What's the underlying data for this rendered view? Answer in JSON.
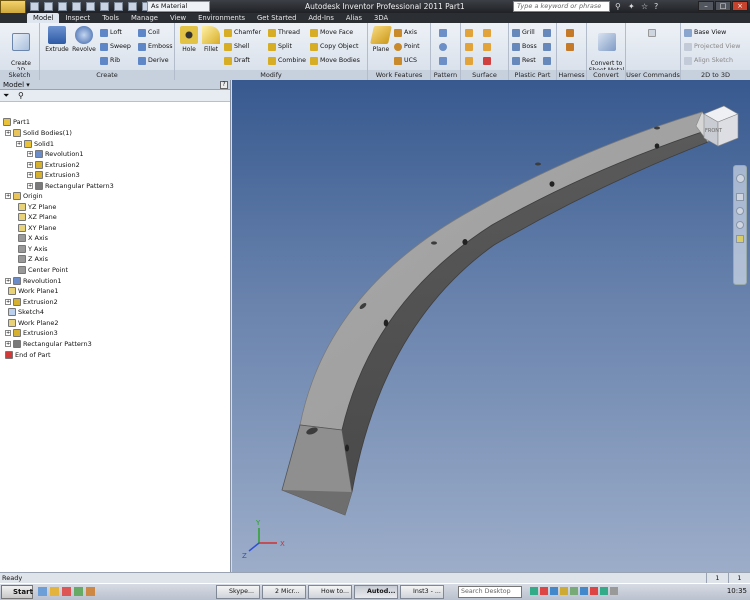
{
  "app": {
    "title": "Autodesk Inventor Professional 2011    Part1",
    "material": "As Material",
    "search_placeholder": "Type a keyword or phrase",
    "app_button": "PRO"
  },
  "tabs": [
    "Model",
    "Inspect",
    "Tools",
    "Manage",
    "View",
    "Environments",
    "Get Started",
    "Add-Ins",
    "Alias",
    "3DA"
  ],
  "ribbon": {
    "sketch": {
      "label": "Sketch",
      "create_2d_sketch": "Create\n2D Sketch"
    },
    "create": {
      "label": "Create",
      "extrude": "Extrude",
      "revolve": "Revolve",
      "loft": "Loft",
      "sweep": "Sweep",
      "rib": "Rib",
      "coil": "Coil",
      "emboss": "Emboss",
      "derive": "Derive"
    },
    "modify": {
      "label": "Modify",
      "hole": "Hole",
      "fillet": "Fillet",
      "chamfer": "Chamfer",
      "shell": "Shell",
      "draft": "Draft",
      "thread": "Thread",
      "split": "Split",
      "combine": "Combine",
      "move_face": "Move Face",
      "copy_object": "Copy Object",
      "move_bodies": "Move Bodies"
    },
    "work_features": {
      "label": "Work Features",
      "plane": "Plane",
      "axis": "Axis",
      "point": "Point",
      "ucs": "UCS"
    },
    "pattern": {
      "label": "Pattern"
    },
    "surface": {
      "label": "Surface"
    },
    "plastic_part": {
      "label": "Plastic Part",
      "grill": "Grill",
      "boss": "Boss",
      "rest": "Rest"
    },
    "harness": {
      "label": "Harness"
    },
    "convert": {
      "label": "Convert",
      "convert_to_sheet_metal": "Convert to\nSheet Metal"
    },
    "user_commands": {
      "label": "User Commands"
    },
    "to_3d": {
      "label": "2D to 3D",
      "base_view": "Base View",
      "projected_view": "Projected View",
      "align_sketch": "Align Sketch"
    }
  },
  "browser": {
    "title": "Model",
    "help": "?",
    "nodes": [
      {
        "label": "Part1",
        "icon": "part-icon",
        "color": "#e9c23a"
      },
      {
        "label": "Solid Bodies(1)",
        "icon": "folder-icon",
        "color": "#e8c45b"
      },
      {
        "label": "Solid1",
        "icon": "solid-icon",
        "color": "#e9c23a"
      },
      {
        "label": "Revolution1",
        "icon": "revolve-icon",
        "color": "#6a8cc9"
      },
      {
        "label": "Extrusion2",
        "icon": "extrude-icon",
        "color": "#d6b12f"
      },
      {
        "label": "Extrusion3",
        "icon": "extrude-icon",
        "color": "#d6b12f"
      },
      {
        "label": "Rectangular Pattern3",
        "icon": "pattern-icon",
        "color": "#7a7a7a"
      },
      {
        "label": "Origin",
        "icon": "folder-icon",
        "color": "#e8c45b"
      },
      {
        "label": "YZ Plane",
        "icon": "plane-icon",
        "color": "#e8d27a"
      },
      {
        "label": "XZ Plane",
        "icon": "plane-icon",
        "color": "#e8d27a"
      },
      {
        "label": "XY Plane",
        "icon": "plane-icon",
        "color": "#e8d27a"
      },
      {
        "label": "X Axis",
        "icon": "axis-icon",
        "color": "#999999"
      },
      {
        "label": "Y Axis",
        "icon": "axis-icon",
        "color": "#999999"
      },
      {
        "label": "Z Axis",
        "icon": "axis-icon",
        "color": "#999999"
      },
      {
        "label": "Center Point",
        "icon": "point-icon",
        "color": "#999999"
      },
      {
        "label": "Revolution1",
        "icon": "revolve-icon",
        "color": "#6a8cc9"
      },
      {
        "label": "Work Plane1",
        "icon": "plane-icon",
        "color": "#e8d27a"
      },
      {
        "label": "Extrusion2",
        "icon": "extrude-icon",
        "color": "#d6b12f"
      },
      {
        "label": "Sketch4",
        "icon": "sketch-icon",
        "color": "#bcd1ee"
      },
      {
        "label": "Work Plane2",
        "icon": "plane-icon",
        "color": "#e8d27a"
      },
      {
        "label": "Extrusion3",
        "icon": "extrude-icon",
        "color": "#d6b12f"
      },
      {
        "label": "Rectangular Pattern3",
        "icon": "pattern-icon",
        "color": "#7a7a7a"
      },
      {
        "label": "End of Part",
        "icon": "end-of-part-icon",
        "color": "#d23a3a"
      }
    ]
  },
  "viewcube": {
    "label": "FRONT"
  },
  "triad": {
    "x": "X",
    "y": "Y",
    "z": "Z"
  },
  "status": {
    "text": "Ready",
    "count1": "1",
    "count2": "1"
  },
  "taskbar": {
    "start": "Start",
    "buttons": [
      "Skype...",
      "2 Micr...",
      "How to...",
      "Autod...",
      "Inst3 - ..."
    ],
    "search_placeholder": "Search Desktop",
    "clock": "10:35"
  }
}
